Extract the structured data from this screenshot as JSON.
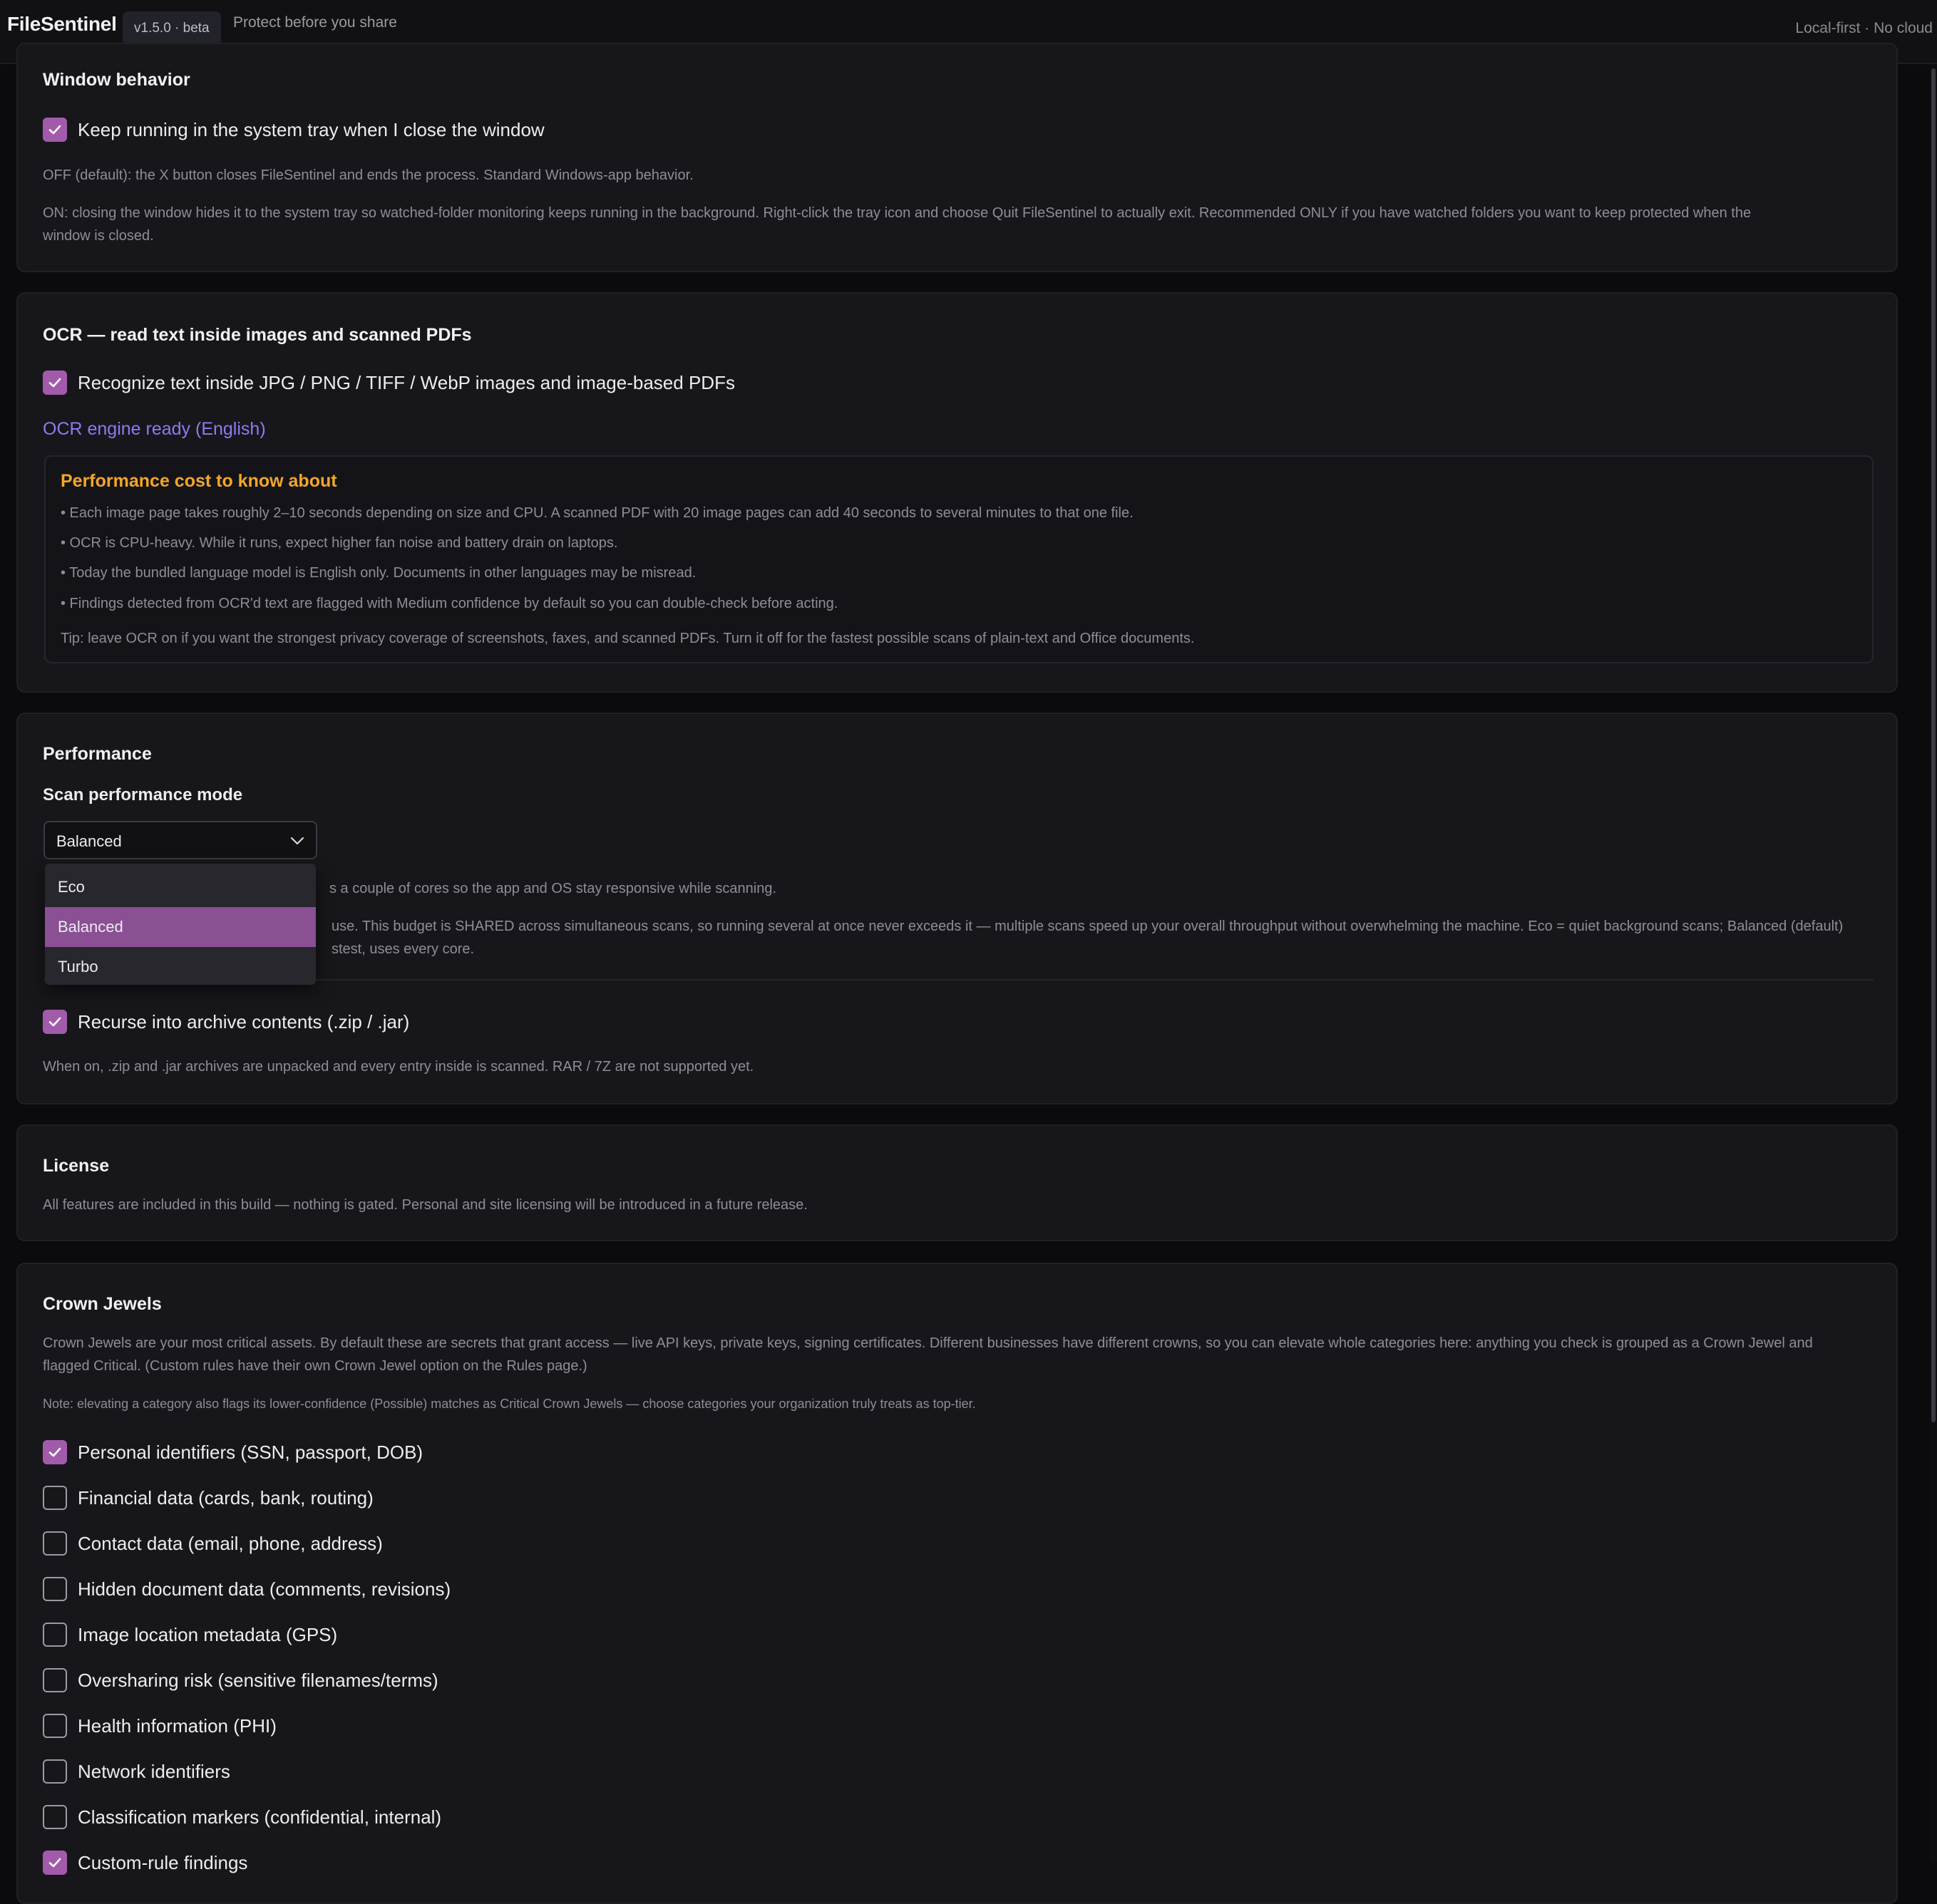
{
  "header": {
    "app_name": "FileSentinel",
    "version": "v1.5.0 · beta",
    "tagline": "Protect before you share",
    "right_text": "Local-first · No cloud"
  },
  "window_behavior": {
    "title": "Window behavior",
    "tray_option": {
      "label": "Keep running in the system tray when I close the window",
      "checked": true
    },
    "off_desc": "OFF (default): the X button closes FileSentinel and ends the process. Standard Windows-app behavior.",
    "on_desc_line1": "ON: closing the window hides it to the system tray so watched-folder monitoring keeps running in the background. Right-click the tray icon and choose Quit FileSentinel to actually exit. Recommended ONLY if you have watched folders you want to keep protected when the",
    "on_desc_line2": "window is closed."
  },
  "ocr": {
    "title": "OCR — read text inside images and scanned PDFs",
    "option": {
      "label": "Recognize text inside JPG / PNG / TIFF / WebP images and image-based PDFs",
      "checked": true
    },
    "status": "OCR engine ready (English)",
    "perf_heading": "Performance cost to know about",
    "bullets": [
      "• Each image page takes roughly 2–10 seconds depending on size and CPU. A scanned PDF with 20 image pages can add 40 seconds to several minutes to that one file.",
      "• OCR is CPU-heavy. While it runs, expect higher fan noise and battery drain on laptops.",
      "• Today the bundled language model is English only. Documents in other languages may be misread.",
      "• Findings detected from OCR'd text are flagged with Medium confidence by default so you can double-check before acting."
    ],
    "tip": "Tip: leave OCR on if you want the strongest privacy coverage of screenshots, faxes, and scanned PDFs. Turn it off for the fastest possible scans of plain-text and Office documents."
  },
  "performance": {
    "title": "Performance",
    "mode_label": "Scan performance mode",
    "selected": "Balanced",
    "options": [
      "Eco",
      "Balanced",
      "Turbo"
    ],
    "desc1_visible": "s a couple of cores so the app and OS stay responsive while scanning.",
    "desc2_line1_visible": "use. This budget is SHARED across simultaneous scans, so running several at once never exceeds it — multiple scans speed up your overall throughput without overwhelming the machine. Eco = quiet background scans; Balanced (default)",
    "desc2_line2_visible": "stest, uses every core.",
    "archive_option": {
      "label": "Recurse into archive contents (.zip / .jar)",
      "checked": true
    },
    "archive_desc": "When on, .zip and .jar archives are unpacked and every entry inside is scanned. RAR / 7Z are not supported yet."
  },
  "license": {
    "title": "License",
    "desc": "All features are included in this build — nothing is gated. Personal and site licensing will be introduced in a future release."
  },
  "crown_jewels": {
    "title": "Crown Jewels",
    "desc_line1": "Crown Jewels are your most critical assets. By default these are secrets that grant access — live API keys, private keys, signing certificates. Different businesses have different crowns, so you can elevate whole categories here: anything you check is grouped as a Crown Jewel and",
    "desc_line2": "flagged Critical. (Custom rules have their own Crown Jewel option on the Rules page.)",
    "note": "Note: elevating a category also flags its lower-confidence (Possible) matches as Critical Crown Jewels — choose categories your organization truly treats as top-tier.",
    "categories": [
      {
        "label": "Personal identifiers (SSN, passport, DOB)",
        "checked": true
      },
      {
        "label": "Financial data (cards, bank, routing)",
        "checked": false
      },
      {
        "label": "Contact data (email, phone, address)",
        "checked": false
      },
      {
        "label": "Hidden document data (comments, revisions)",
        "checked": false
      },
      {
        "label": "Image location metadata (GPS)",
        "checked": false
      },
      {
        "label": "Oversharing risk (sensitive filenames/terms)",
        "checked": false
      },
      {
        "label": "Health information (PHI)",
        "checked": false
      },
      {
        "label": "Network identifiers",
        "checked": false
      },
      {
        "label": "Classification markers (confidential, internal)",
        "checked": false
      },
      {
        "label": "Custom-rule findings",
        "checked": true
      }
    ]
  },
  "colors": {
    "accent": "#a25bab",
    "selected_option": "#8b4f93",
    "status_link": "#8b7cf0",
    "warning_heading": "#f3a62a"
  }
}
